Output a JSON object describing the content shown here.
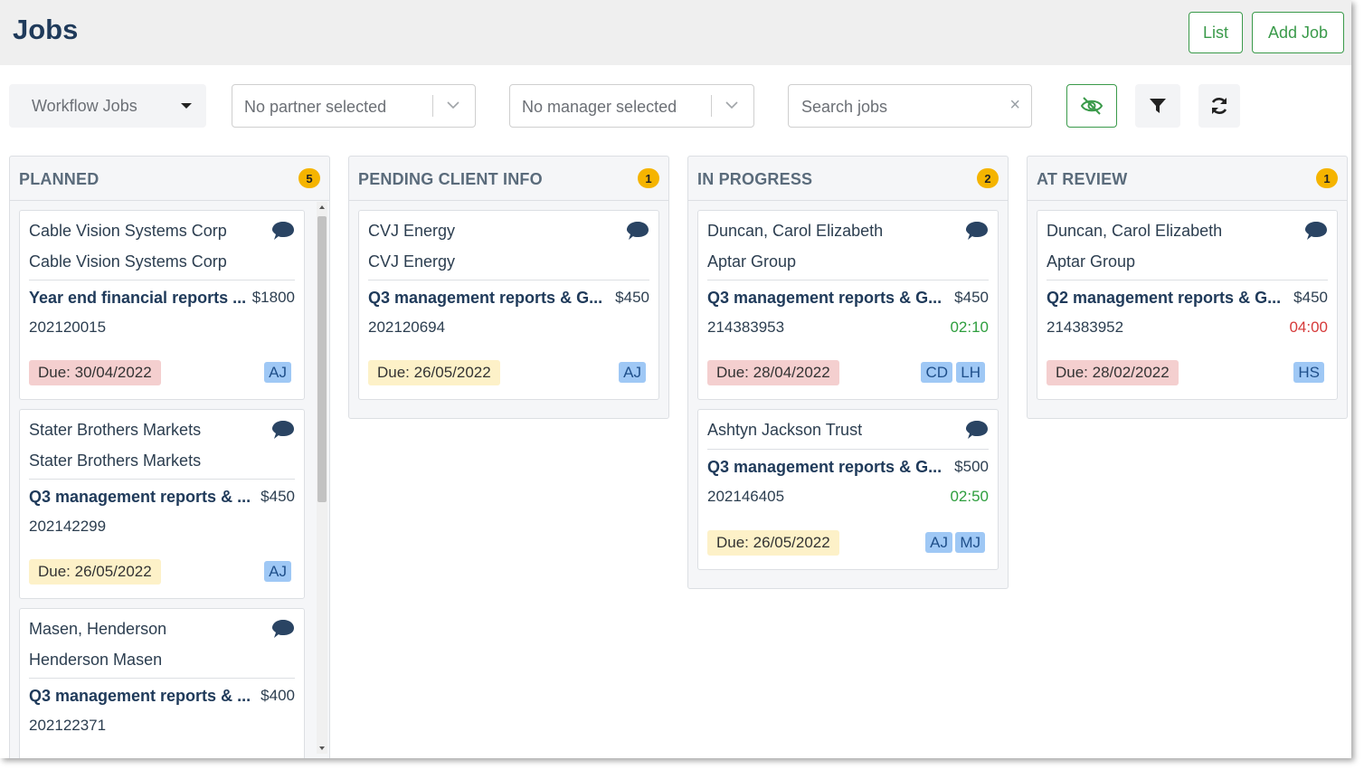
{
  "header": {
    "title": "Jobs",
    "list_label": "List",
    "add_job_label": "Add Job"
  },
  "filters": {
    "workflow_label": "Workflow Jobs",
    "partner_label": "No partner selected",
    "manager_label": "No manager selected",
    "search_placeholder": "Search jobs",
    "clear_icon": "×"
  },
  "colors": {
    "accent_green": "#3a9a4a",
    "badge_yellow": "#f5b400",
    "due_overdue": "#f4cfcf",
    "due_upcoming": "#fdf1c8",
    "initials_bg": "#9fc8f5",
    "time_ok": "#2e9e3e",
    "time_over": "#d63a3a"
  },
  "columns": [
    {
      "title": "PLANNED",
      "count": "5",
      "cards": [
        {
          "client": "Cable Vision Systems Corp",
          "group": "Cable Vision Systems Corp",
          "job": "Year end financial reports ...",
          "fee": "$1800",
          "job_no": "202120015",
          "time": "",
          "due": "Due: 30/04/2022",
          "due_status": "overdue",
          "staff": [
            "AJ"
          ]
        },
        {
          "client": "Stater Brothers Markets",
          "group": "Stater Brothers Markets",
          "job": "Q3 management reports & ...",
          "fee": "$450",
          "job_no": "202142299",
          "time": "",
          "due": "Due: 26/05/2022",
          "due_status": "upcoming",
          "staff": [
            "AJ"
          ]
        },
        {
          "client": "Masen, Henderson",
          "group": "Henderson Masen",
          "job": "Q3 management reports & ...",
          "fee": "$400",
          "job_no": "202122371",
          "time": "",
          "due": "",
          "due_status": "",
          "staff": []
        }
      ]
    },
    {
      "title": "PENDING CLIENT INFO",
      "count": "1",
      "cards": [
        {
          "client": "CVJ Energy",
          "group": "CVJ Energy",
          "job": "Q3 management reports & G...",
          "fee": "$450",
          "job_no": "202120694",
          "time": "",
          "due": "Due: 26/05/2022",
          "due_status": "upcoming",
          "staff": [
            "AJ"
          ]
        }
      ]
    },
    {
      "title": "IN PROGRESS",
      "count": "2",
      "cards": [
        {
          "client": "Duncan, Carol Elizabeth",
          "group": "Aptar Group",
          "job": "Q3 management reports & G...",
          "fee": "$450",
          "job_no": "214383953",
          "time": "02:10",
          "time_status": "ok",
          "due": "Due: 28/04/2022",
          "due_status": "overdue",
          "staff": [
            "CD",
            "LH"
          ]
        },
        {
          "client": "Ashtyn Jackson Trust",
          "group": "",
          "job": "Q3 management reports & G...",
          "fee": "$500",
          "job_no": "202146405",
          "time": "02:50",
          "time_status": "ok",
          "due": "Due: 26/05/2022",
          "due_status": "upcoming",
          "staff": [
            "AJ",
            "MJ"
          ]
        }
      ]
    },
    {
      "title": "AT REVIEW",
      "count": "1",
      "cards": [
        {
          "client": "Duncan, Carol Elizabeth",
          "group": "Aptar Group",
          "job": "Q2 management reports & G...",
          "fee": "$450",
          "job_no": "214383952",
          "time": "04:00",
          "time_status": "over",
          "due": "Due: 28/02/2022",
          "due_status": "overdue",
          "staff": [
            "HS"
          ]
        }
      ]
    }
  ]
}
